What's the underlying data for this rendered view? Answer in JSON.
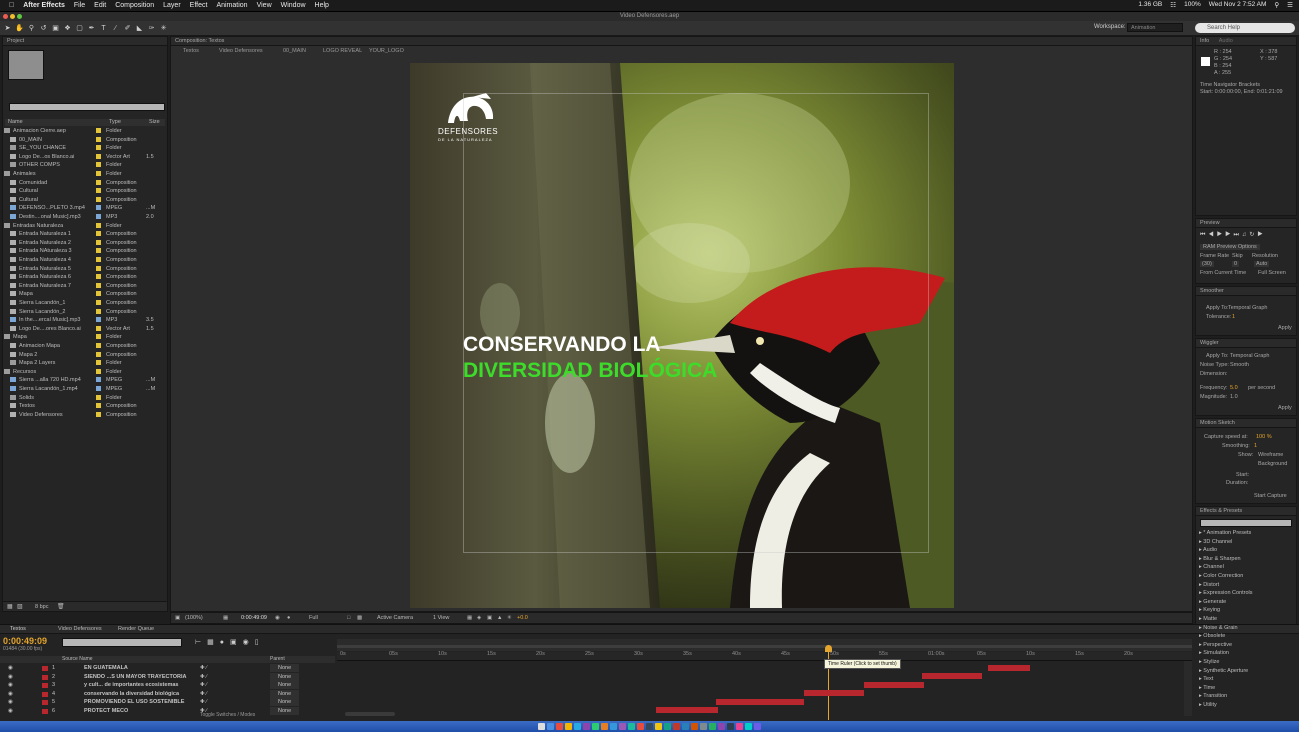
{
  "menubar": {
    "app": "After Effects",
    "items": [
      "File",
      "Edit",
      "Composition",
      "Layer",
      "Effect",
      "Animation",
      "View",
      "Window",
      "Help"
    ],
    "right": [
      "1.36 GB",
      "100%",
      "Wed Nov 2  7:52 AM"
    ]
  },
  "window_title": "Video Defensores.aep",
  "workspace": {
    "label": "Workspace:",
    "value": "Animation"
  },
  "search_help": "Search Help",
  "project": {
    "tab": "Project",
    "search_placeholder": "",
    "columns": [
      "Name",
      "Type",
      "Size"
    ],
    "items": [
      {
        "name": "Animacion Cierre.aep",
        "type": "Folder",
        "size": "",
        "color": "#e3c53a",
        "icon": "folder-icon"
      },
      {
        "name": "00_MAIN",
        "type": "Composition",
        "size": "",
        "color": "#e3c53a",
        "icon": "composition-icon"
      },
      {
        "name": "SE_YOU CHANCE",
        "type": "Folder",
        "size": "",
        "color": "#e3c53a",
        "icon": "folder-icon"
      },
      {
        "name": "Logo De...os Blanco.ai",
        "type": "Vector Art",
        "size": "1.5",
        "color": "#e3c53a",
        "icon": "vector-icon"
      },
      {
        "name": "OTHER COMPS",
        "type": "Folder",
        "size": "",
        "color": "#e3c53a",
        "icon": "folder-icon"
      },
      {
        "name": "Animales",
        "type": "Folder",
        "size": "",
        "color": "#e3c53a",
        "icon": "folder-icon"
      },
      {
        "name": "Comunidad",
        "type": "Composition",
        "size": "",
        "color": "#e3c53a",
        "icon": "composition-icon"
      },
      {
        "name": "Cultural",
        "type": "Composition",
        "size": "",
        "color": "#e3c53a",
        "icon": "composition-icon"
      },
      {
        "name": "Cultural",
        "type": "Composition",
        "size": "",
        "color": "#e3c53a",
        "icon": "composition-icon"
      },
      {
        "name": "DEFENSO...PLETO 3.mp4",
        "type": "MPEG",
        "size": "...M",
        "color": "#7ba6d6",
        "icon": "video-icon"
      },
      {
        "name": "Destin....onal Music].mp3",
        "type": "MP3",
        "size": "2.0",
        "color": "#7ba6d6",
        "icon": "audio-icon"
      },
      {
        "name": "Entradas Naturaleza",
        "type": "Folder",
        "size": "",
        "color": "#e3c53a",
        "icon": "folder-icon"
      },
      {
        "name": "Entrada Naturaleza 1",
        "type": "Composition",
        "size": "",
        "color": "#e3c53a",
        "icon": "composition-icon"
      },
      {
        "name": "Entrada Naturaleza 2",
        "type": "Composition",
        "size": "",
        "color": "#e3c53a",
        "icon": "composition-icon"
      },
      {
        "name": "Entrada NAturaleza 3",
        "type": "Composition",
        "size": "",
        "color": "#e3c53a",
        "icon": "composition-icon"
      },
      {
        "name": "Entrada Naturaleza 4",
        "type": "Composition",
        "size": "",
        "color": "#e3c53a",
        "icon": "composition-icon"
      },
      {
        "name": "Entrada Naturaleza 5",
        "type": "Composition",
        "size": "",
        "color": "#e3c53a",
        "icon": "composition-icon"
      },
      {
        "name": "Entrada Naturaleza 6",
        "type": "Composition",
        "size": "",
        "color": "#e3c53a",
        "icon": "composition-icon"
      },
      {
        "name": "Entrada Naturaleza 7",
        "type": "Composition",
        "size": "",
        "color": "#e3c53a",
        "icon": "composition-icon"
      },
      {
        "name": "Mapa",
        "type": "Composition",
        "size": "",
        "color": "#e3c53a",
        "icon": "composition-icon"
      },
      {
        "name": "Sierra Lacandón_1",
        "type": "Composition",
        "size": "",
        "color": "#e3c53a",
        "icon": "composition-icon"
      },
      {
        "name": "Sierra Lacandón_2",
        "type": "Composition",
        "size": "",
        "color": "#e3c53a",
        "icon": "composition-icon"
      },
      {
        "name": "In the....ercal Music].mp3",
        "type": "MP3",
        "size": "3.5",
        "color": "#7ba6d6",
        "icon": "audio-icon"
      },
      {
        "name": "Logo De....ores Blanco.ai",
        "type": "Vector Art",
        "size": "1.5",
        "color": "#e3c53a",
        "icon": "vector-icon"
      },
      {
        "name": "Mapa",
        "type": "Folder",
        "size": "",
        "color": "#e3c53a",
        "icon": "folder-icon"
      },
      {
        "name": "Animacion Mapa",
        "type": "Composition",
        "size": "",
        "color": "#e3c53a",
        "icon": "composition-icon"
      },
      {
        "name": "Mapa 2",
        "type": "Composition",
        "size": "",
        "color": "#e3c53a",
        "icon": "composition-icon"
      },
      {
        "name": "Mapa 2 Layers",
        "type": "Folder",
        "size": "",
        "color": "#e3c53a",
        "icon": "folder-icon"
      },
      {
        "name": "Recursos",
        "type": "Folder",
        "size": "",
        "color": "#e3c53a",
        "icon": "folder-icon"
      },
      {
        "name": "Sierra ...alla 720 HD.mp4",
        "type": "MPEG",
        "size": "...M",
        "color": "#7ba6d6",
        "icon": "video-icon"
      },
      {
        "name": "Sierra Lacandón_1.mp4",
        "type": "MPEG",
        "size": "...M",
        "color": "#7ba6d6",
        "icon": "video-icon"
      },
      {
        "name": "Solids",
        "type": "Folder",
        "size": "",
        "color": "#e3c53a",
        "icon": "folder-icon"
      },
      {
        "name": "Textos",
        "type": "Composition",
        "size": "",
        "color": "#e3c53a",
        "icon": "composition-icon"
      },
      {
        "name": "Video Defensores",
        "type": "Composition",
        "size": "",
        "color": "#e3c53a",
        "icon": "composition-icon"
      }
    ],
    "footer_bpc": "8 bpc"
  },
  "composition": {
    "tab": "Composition: Textos",
    "breadcrumbs": [
      "Textos",
      "Video Defensores",
      "00_MAIN",
      "LOGO REVEAL",
      "YOUR_LOGO"
    ],
    "logo_text": "DEFENSORES",
    "logo_sub": "DE LA NATURALEZA",
    "headline_line1": "CONSERVANDO LA",
    "headline_line2": "DIVERSIDAD BIOLÓGICA",
    "headline_color_1": "#ffffff",
    "headline_color_2": "#3ddc2b",
    "zoom": "(100%)",
    "timecode": "0:00:49:09",
    "resolution": "Full",
    "camera": "Active Camera",
    "view": "1 View",
    "exposure": "+0.0"
  },
  "info_panel": {
    "tabs": [
      "Info",
      "Audio"
    ],
    "r": "R : 254",
    "g": "G : 254",
    "b": "B : 254",
    "a": "A : 255",
    "x": "X : 378",
    "y": "Y : 587",
    "note1": "Time Navigator Brackets",
    "note2": "Start: 0:00:00:00, End: 0:01:21:09"
  },
  "preview_panel": {
    "tab": "Preview",
    "ram_options": "RAM Preview Options",
    "frame_rate_label": "Frame Rate",
    "skip_label": "Skip",
    "resolution_label": "Resolution",
    "frame_rate": "(30)",
    "skip": "0",
    "resolution": "Auto",
    "from_current": "From Current Time",
    "full_screen": "Full Screen"
  },
  "smoother_panel": {
    "tab": "Smoother",
    "apply_to_label": "Apply To:",
    "apply_to": "Temporal Graph",
    "tolerance_label": "Tolerance:",
    "tolerance": "1",
    "apply": "Apply"
  },
  "wiggler_panel": {
    "tab": "Wiggler",
    "apply_to_label": "Apply To:",
    "apply_to": "Temporal Graph",
    "noise_label": "Noise Type:",
    "noise": "Smooth",
    "dimensions_label": "Dimension:",
    "frequency_label": "Frequency:",
    "frequency": "5.0",
    "frequency_unit": "per second",
    "magnitude_label": "Magnitude:",
    "magnitude": "1.0",
    "apply": "Apply"
  },
  "motion_sketch": {
    "tab": "Motion Sketch",
    "capture_label": "Capture speed at:",
    "capture": "100 %",
    "smoothing_label": "Smoothing:",
    "smoothing": "1",
    "show_label": "Show:",
    "wireframe": "Wireframe",
    "background": "Background",
    "start_label": "Start:",
    "duration_label": "Duration:",
    "start_capture": "Start Capture"
  },
  "effects": {
    "tab": "Effects & Presets",
    "items": [
      "* Animation Presets",
      "3D Channel",
      "Audio",
      "Blur & Sharpen",
      "Channel",
      "Color Correction",
      "Distort",
      "Expression Controls",
      "Generate",
      "Keying",
      "Matte",
      "Noise & Grain",
      "Obsolete",
      "Perspective",
      "Simulation",
      "Stylize",
      "Synthetic Aperture",
      "Text",
      "Time",
      "Transition",
      "Utility"
    ]
  },
  "timeline": {
    "tabs": [
      "Textos",
      "Video Defensores",
      "Render Queue"
    ],
    "timecode": "0:00:49:09",
    "frame": "01484 (30.00 fps)",
    "column_source": "Source Name",
    "column_parent": "Parent",
    "ruler": [
      "0s",
      "05s",
      "10s",
      "15s",
      "20s",
      "25s",
      "30s",
      "35s",
      "40s",
      "45s",
      "50s",
      "55s",
      "01:00s",
      "05s",
      "10s",
      "15s",
      "20s"
    ],
    "tooltip": "Time Ruler (Click to set thumb)",
    "layers": [
      {
        "num": "1",
        "name": "EN GUATEMALA",
        "parent": "None"
      },
      {
        "num": "2",
        "name": "SIENDO ...S  UN MAYOR TRAYECTORIA",
        "parent": "None"
      },
      {
        "num": "3",
        "name": "y cult...  de importantes ecosistemas",
        "parent": "None"
      },
      {
        "num": "4",
        "name": "conservando la  diversidad biológica",
        "parent": "None"
      },
      {
        "num": "5",
        "name": "PROMOVIENDO  EL USO SOSTENIBLE",
        "parent": "None"
      },
      {
        "num": "6",
        "name": "PROTECT MECO",
        "parent": "None"
      }
    ],
    "toggle": "Toggle Switches / Modes"
  }
}
